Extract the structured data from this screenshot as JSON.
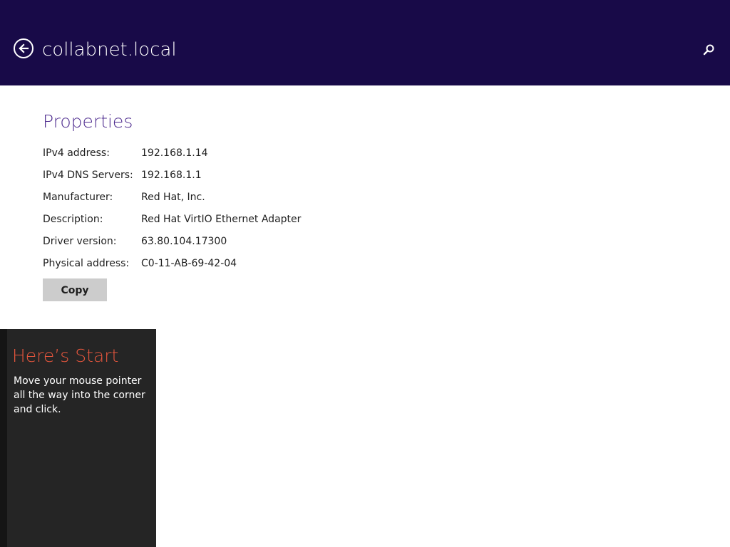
{
  "header": {
    "title": "collabnet.local",
    "back_icon": "back-arrow-icon",
    "search_icon": "search-icon",
    "background_color": "#180a48"
  },
  "properties": {
    "title": "Properties",
    "title_color": "#4f2d8f",
    "rows": [
      {
        "label": "IPv4 address:",
        "value": "192.168.1.14"
      },
      {
        "label": "IPv4 DNS Servers:",
        "value": "192.168.1.1"
      },
      {
        "label": "Manufacturer:",
        "value": "Red Hat, Inc."
      },
      {
        "label": "Description:",
        "value": "Red Hat VirtIO Ethernet Adapter"
      },
      {
        "label": "Driver version:",
        "value": "63.80.104.17300"
      },
      {
        "label": "Physical address:",
        "value": "C0-11-AB-69-42-04"
      }
    ],
    "copy_label": "Copy"
  },
  "start_tip": {
    "title": "Here’s Start",
    "body": "Move your mouse pointer all the way into the corner and click.",
    "title_color": "#e5563d"
  }
}
